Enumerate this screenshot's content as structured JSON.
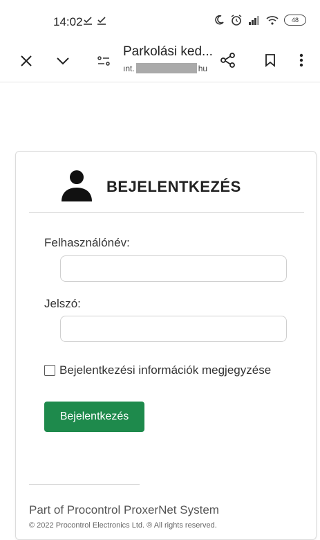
{
  "status": {
    "time": "14:02",
    "download_icons": [
      "download-done-icon",
      "download-done-icon"
    ],
    "icons": [
      "moon-icon",
      "alarm-icon",
      "signal-icon",
      "wifi-icon"
    ],
    "battery": "48"
  },
  "toolbar": {
    "title": "Parkolási ked...",
    "url_prefix": "ınt.",
    "url_suffix": "hu",
    "icons": [
      "close-icon",
      "chevron-down-icon",
      "page-settings-icon",
      "share-icon",
      "bookmark-icon",
      "more-icon"
    ]
  },
  "login": {
    "title": "BEJELENTKEZÉS",
    "username_label": "Felhasználónév:",
    "username_value": "",
    "password_label": "Jelszó:",
    "password_value": "",
    "remember_label": "Bejelentkezési információk megjegyzése",
    "remember_checked": false,
    "submit_label": "Bejelentkezés"
  },
  "footer": {
    "title": "Part of Procontrol ProxerNet System",
    "copyright": "© 2022 Procontrol Electronics Ltd. ® All rights reserved."
  },
  "colors": {
    "accent": "#1e8a4c",
    "card_border": "#dcdcdc"
  }
}
